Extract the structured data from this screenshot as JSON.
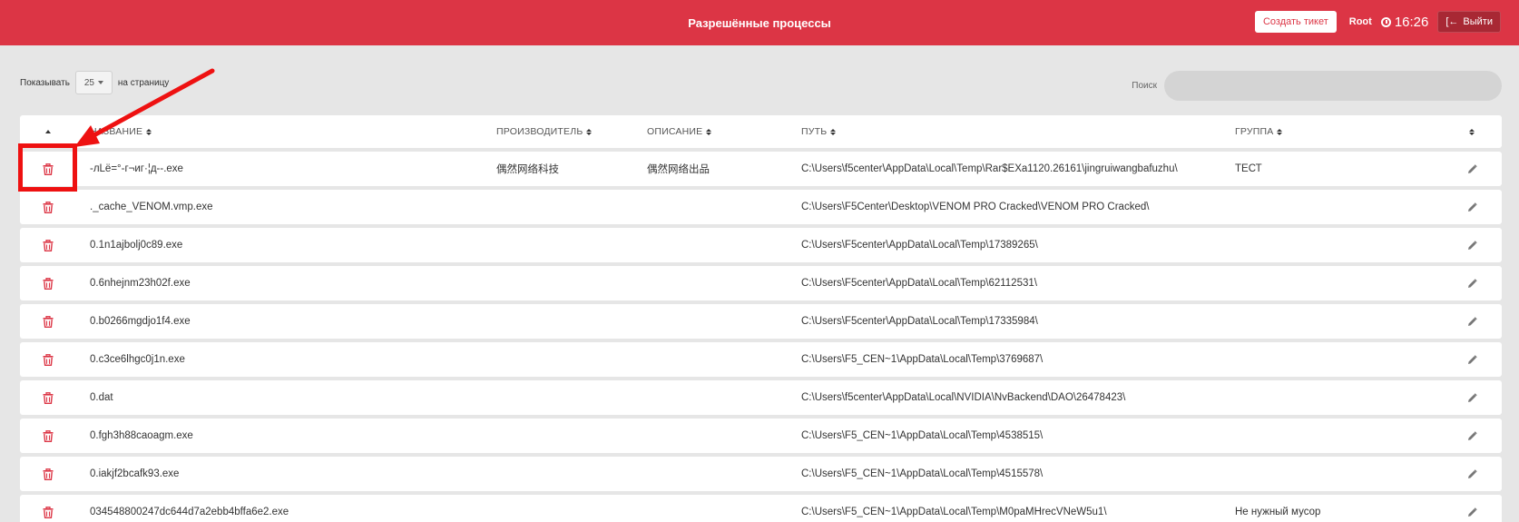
{
  "header": {
    "title": "Разрешённые процессы",
    "ticket_button": "Создать тикет",
    "user": "Root",
    "time": "16:26",
    "logout_button": "Выйти",
    "accent_color": "#dc3545"
  },
  "controls": {
    "show_label": "Показывать",
    "page_size": "25",
    "per_page_label": "на страницу",
    "search_label": "Поиск",
    "search_value": ""
  },
  "columns": {
    "name": "НАЗВАНИЕ",
    "vendor": "ПРОИЗВОДИТЕЛЬ",
    "description": "ОПИСАНИЕ",
    "path": "ПУТЬ",
    "group": "ГРУППА"
  },
  "rows": [
    {
      "name": "-лLё=°-г¬иг·¦д-‐.exe",
      "vendor": "偶然网络科技",
      "description": "偶然网络出品",
      "path": "C:\\Users\\f5center\\AppData\\Local\\Temp\\Rar$EXa1120.26161\\jingruiwangbafuzhu\\",
      "group": "ТЕСТ"
    },
    {
      "name": "._cache_VENOM.vmp.exe",
      "vendor": "",
      "description": "",
      "path": "C:\\Users\\F5Center\\Desktop\\VENOM PRO Cracked\\VENOM PRO Cracked\\",
      "group": ""
    },
    {
      "name": "0.1n1ajbolj0c89.exe",
      "vendor": "",
      "description": "",
      "path": "C:\\Users\\F5center\\AppData\\Local\\Temp\\17389265\\",
      "group": ""
    },
    {
      "name": "0.6nhejnm23h02f.exe",
      "vendor": "",
      "description": "",
      "path": "C:\\Users\\F5center\\AppData\\Local\\Temp\\62112531\\",
      "group": ""
    },
    {
      "name": "0.b0266mgdjo1f4.exe",
      "vendor": "",
      "description": "",
      "path": "C:\\Users\\F5center\\AppData\\Local\\Temp\\17335984\\",
      "group": ""
    },
    {
      "name": "0.c3ce6lhgc0j1n.exe",
      "vendor": "",
      "description": "",
      "path": "C:\\Users\\F5_CEN~1\\AppData\\Local\\Temp\\3769687\\",
      "group": ""
    },
    {
      "name": "0.dat",
      "vendor": "",
      "description": "",
      "path": "C:\\Users\\f5center\\AppData\\Local\\NVIDIA\\NvBackend\\DAO\\26478423\\",
      "group": ""
    },
    {
      "name": "0.fgh3h88caoagm.exe",
      "vendor": "",
      "description": "",
      "path": "C:\\Users\\F5_CEN~1\\AppData\\Local\\Temp\\4538515\\",
      "group": ""
    },
    {
      "name": "0.iakjf2bcafk93.exe",
      "vendor": "",
      "description": "",
      "path": "C:\\Users\\F5_CEN~1\\AppData\\Local\\Temp\\4515578\\",
      "group": ""
    },
    {
      "name": "034548800247dc644d7a2ebb4bffa6e2.exe",
      "vendor": "",
      "description": "",
      "path": "C:\\Users\\F5_CEN~1\\AppData\\Local\\Temp\\M0paMHrecVNeW5u1\\",
      "group": "Не нужный мусор"
    }
  ],
  "icons": {
    "delete": "trash-icon",
    "edit": "pencil-icon",
    "clock": "clock-icon",
    "logout": "logout-icon"
  }
}
